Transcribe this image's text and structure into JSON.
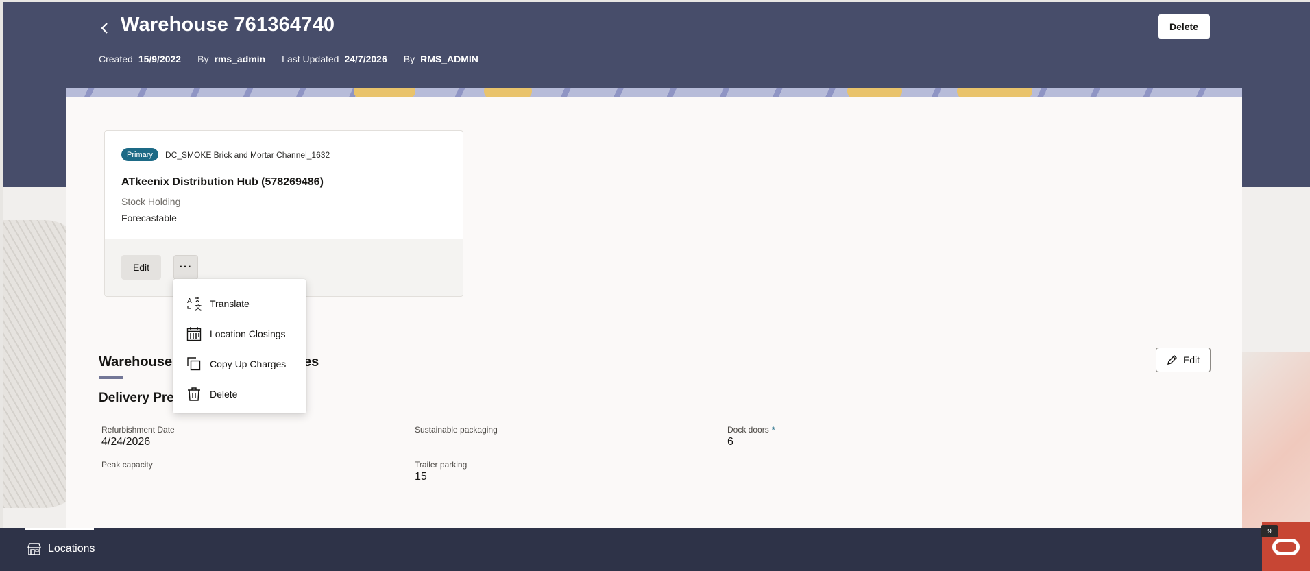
{
  "header": {
    "title": "Warehouse 761364740",
    "created_label": "Created",
    "created_value": "15/9/2022",
    "created_by_label": "By",
    "created_by_value": "rms_admin",
    "updated_label": "Last Updated",
    "updated_value": "24/7/2026",
    "updated_by_label": "By",
    "updated_by_value": "RMS_ADMIN",
    "delete_label": "Delete",
    "back_icon": "chevron-left-icon"
  },
  "card": {
    "badge": "Primary",
    "channel": "DC_SMOKE Brick and Mortar Channel_1632",
    "title": "ATkeenix Distribution Hub (578269486)",
    "subtitle": "Stock Holding",
    "subtitle2": "Forecastable",
    "edit_label": "Edit",
    "more_label": "···"
  },
  "menu": {
    "items": [
      {
        "label": "Translate",
        "icon": "translate-icon"
      },
      {
        "label": "Location Closings",
        "icon": "calendar-icon"
      },
      {
        "label": "Copy Up Charges",
        "icon": "copy-icon"
      },
      {
        "label": "Delete",
        "icon": "trash-icon"
      }
    ]
  },
  "section": {
    "title": "Warehouse",
    "title_tail": "es",
    "edit_label": "Edit",
    "subsection": "Delivery Pre"
  },
  "fields": [
    {
      "label": "Refurbishment Date",
      "value": "4/24/2026"
    },
    {
      "label": "Sustainable packaging",
      "value": ""
    },
    {
      "label": "Dock doors",
      "value": "6",
      "required": "*"
    },
    {
      "label": "Peak capacity",
      "value": ""
    },
    {
      "label": "Trailer parking",
      "value": "15"
    }
  ],
  "bottom": {
    "tab_label": "Locations",
    "notification_count": "9"
  },
  "colors": {
    "header": "#474d6a",
    "badge": "#1d6a86",
    "bottom_bar": "#2e3348",
    "oracle": "#c74634"
  }
}
